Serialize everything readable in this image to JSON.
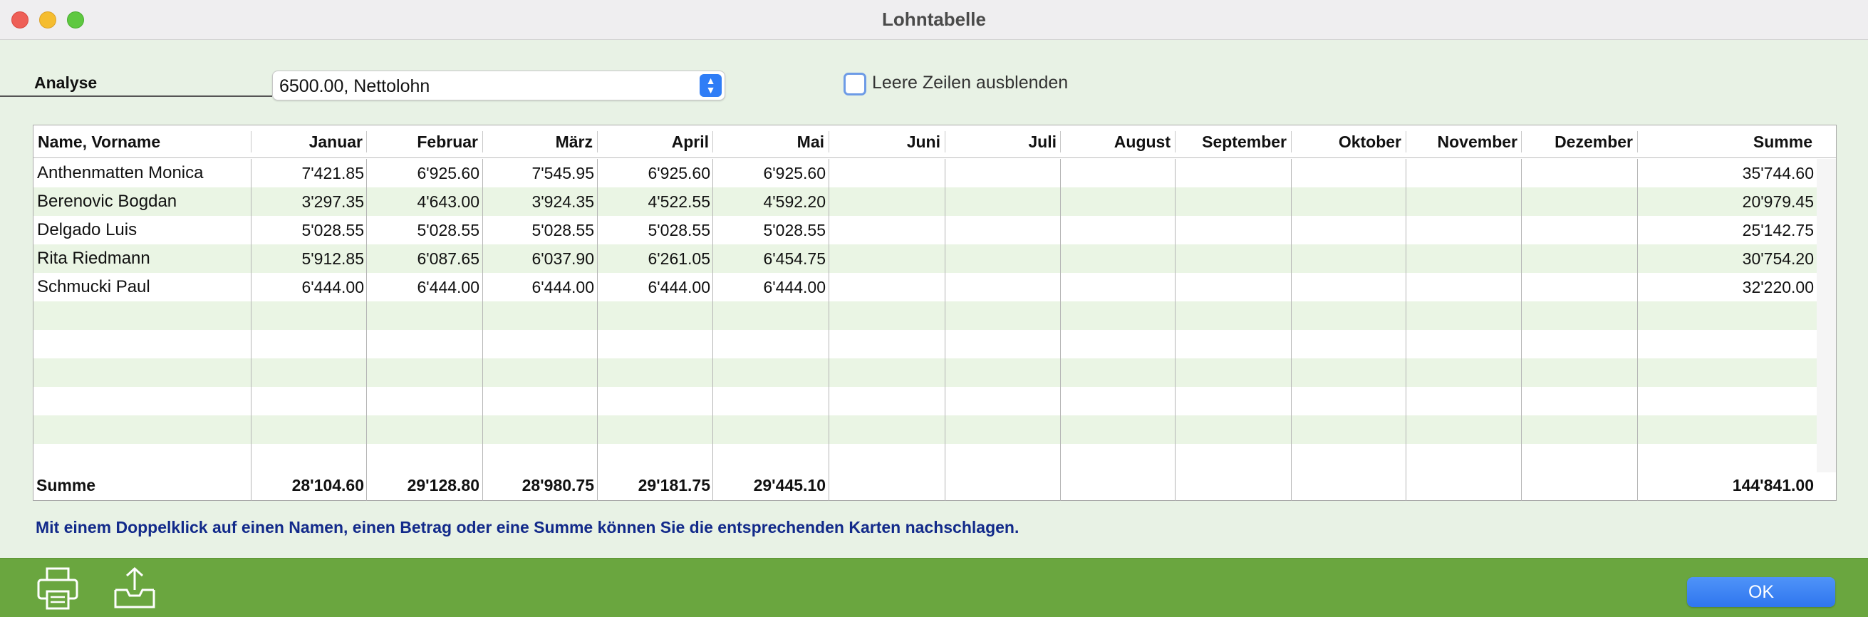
{
  "window": {
    "title": "Lohntabelle"
  },
  "analyse": {
    "label": "Analyse",
    "selected": "6500.00, Nettolohn"
  },
  "hide_empty": {
    "label": "Leere Zeilen ausblenden",
    "checked": false
  },
  "table": {
    "columns": [
      "Name, Vorname",
      "Januar",
      "Februar",
      "März",
      "April",
      "Mai",
      "Juni",
      "Juli",
      "August",
      "September",
      "Oktober",
      "November",
      "Dezember",
      "Summe"
    ],
    "rows": [
      [
        "Anthenmatten Monica",
        "7'421.85",
        "6'925.60",
        "7'545.95",
        "6'925.60",
        "6'925.60",
        "",
        "",
        "",
        "",
        "",
        "",
        "",
        "35'744.60"
      ],
      [
        "Berenovic Bogdan",
        "3'297.35",
        "4'643.00",
        "3'924.35",
        "4'522.55",
        "4'592.20",
        "",
        "",
        "",
        "",
        "",
        "",
        "",
        "20'979.45"
      ],
      [
        "Delgado Luis",
        "5'028.55",
        "5'028.55",
        "5'028.55",
        "5'028.55",
        "5'028.55",
        "",
        "",
        "",
        "",
        "",
        "",
        "",
        "25'142.75"
      ],
      [
        "Rita Riedmann",
        "5'912.85",
        "6'087.65",
        "6'037.90",
        "6'261.05",
        "6'454.75",
        "",
        "",
        "",
        "",
        "",
        "",
        "",
        "30'754.20"
      ],
      [
        "Schmucki Paul",
        "6'444.00",
        "6'444.00",
        "6'444.00",
        "6'444.00",
        "6'444.00",
        "",
        "",
        "",
        "",
        "",
        "",
        "",
        "32'220.00"
      ]
    ],
    "totals": [
      "Summe",
      "28'104.60",
      "29'128.80",
      "28'980.75",
      "29'181.75",
      "29'445.10",
      "",
      "",
      "",
      "",
      "",
      "",
      "",
      "144'841.00"
    ]
  },
  "hint": "Mit einem Doppelklick auf einen Namen, einen Betrag oder eine Summe können Sie die entsprechenden Karten nachschlagen.",
  "footer": {
    "print_icon": "printer-icon",
    "export_icon": "export-icon",
    "ok_label": "OK"
  },
  "colors": {
    "footer": "#6aa63f",
    "row_alt": "#eaf5e4",
    "hint": "#122a8a",
    "accent": "#2f7df6"
  }
}
